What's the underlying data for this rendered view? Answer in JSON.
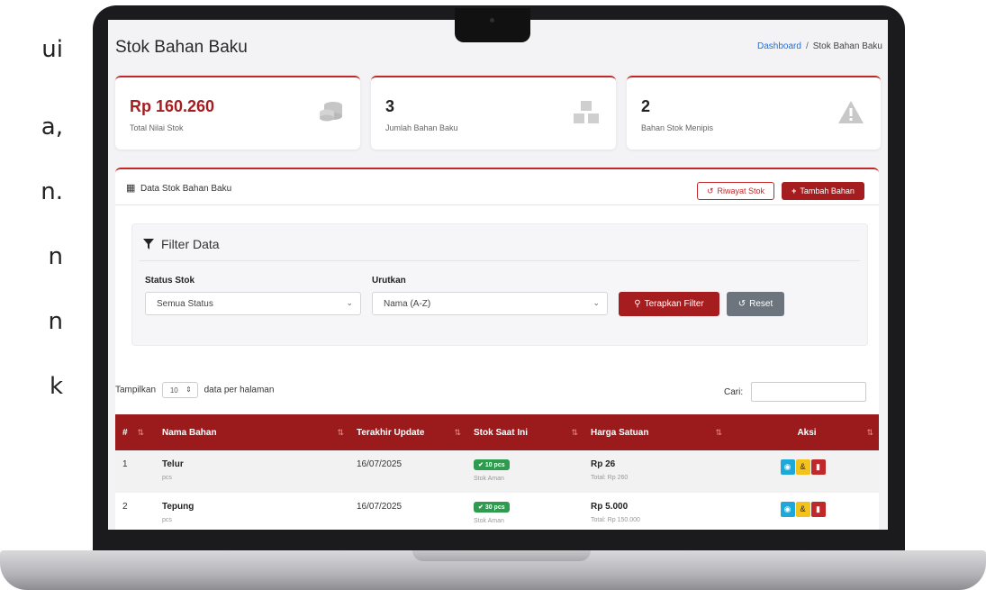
{
  "side_fragments": [
    "ui",
    "a,",
    "n.",
    "n",
    "n",
    "k"
  ],
  "header": {
    "title": "Stok Bahan Baku",
    "breadcrumb_home": "Dashboard",
    "breadcrumb_sep": "/",
    "breadcrumb_current": "Stok Bahan Baku"
  },
  "stats": [
    {
      "value": "Rp 160.260",
      "label": "Total Nilai Stok",
      "icon": "coins-icon",
      "accent": "#a51d1f"
    },
    {
      "value": "3",
      "label": "Jumlah Bahan Baku",
      "icon": "boxes-icon",
      "accent": "#222222"
    },
    {
      "value": "2",
      "label": "Bahan Stok Menipis",
      "icon": "warning-icon",
      "accent": "#222222"
    }
  ],
  "panel": {
    "title": "Data Stok Bahan Baku",
    "history_button": "Riwayat Stok",
    "add_button": "Tambah Bahan"
  },
  "filter": {
    "title": "Filter Data",
    "status_label": "Status Stok",
    "status_value": "Semua Status",
    "sort_label": "Urutkan",
    "sort_value": "Nama (A-Z)",
    "apply_button": "Terapkan Filter",
    "reset_button": "Reset"
  },
  "table_controls": {
    "show_prefix": "Tampilkan",
    "page_size": "10",
    "show_suffix": "data per halaman",
    "search_label": "Cari:"
  },
  "table": {
    "columns": [
      "#",
      "Nama Bahan",
      "Terakhir Update",
      "Stok Saat Ini",
      "Harga Satuan",
      "Aksi"
    ],
    "rows": [
      {
        "no": "1",
        "name": "Telur",
        "unit": "pcs",
        "updated": "16/07/2025",
        "stock": "10 pcs",
        "stock_status": "Stok Aman",
        "price": "Rp 26",
        "total": "Total: Rp 260"
      },
      {
        "no": "2",
        "name": "Tepung",
        "unit": "pcs",
        "updated": "16/07/2025",
        "stock": "30 pcs",
        "stock_status": "Stok Aman",
        "price": "Rp 5.000",
        "total": "Total: Rp 150.000"
      }
    ]
  },
  "colors": {
    "brand": "#a51d1f",
    "header_bg": "#9b1b1d",
    "success": "#2e9b4f",
    "info": "#1ea8d9",
    "warning": "#f4c21a"
  }
}
